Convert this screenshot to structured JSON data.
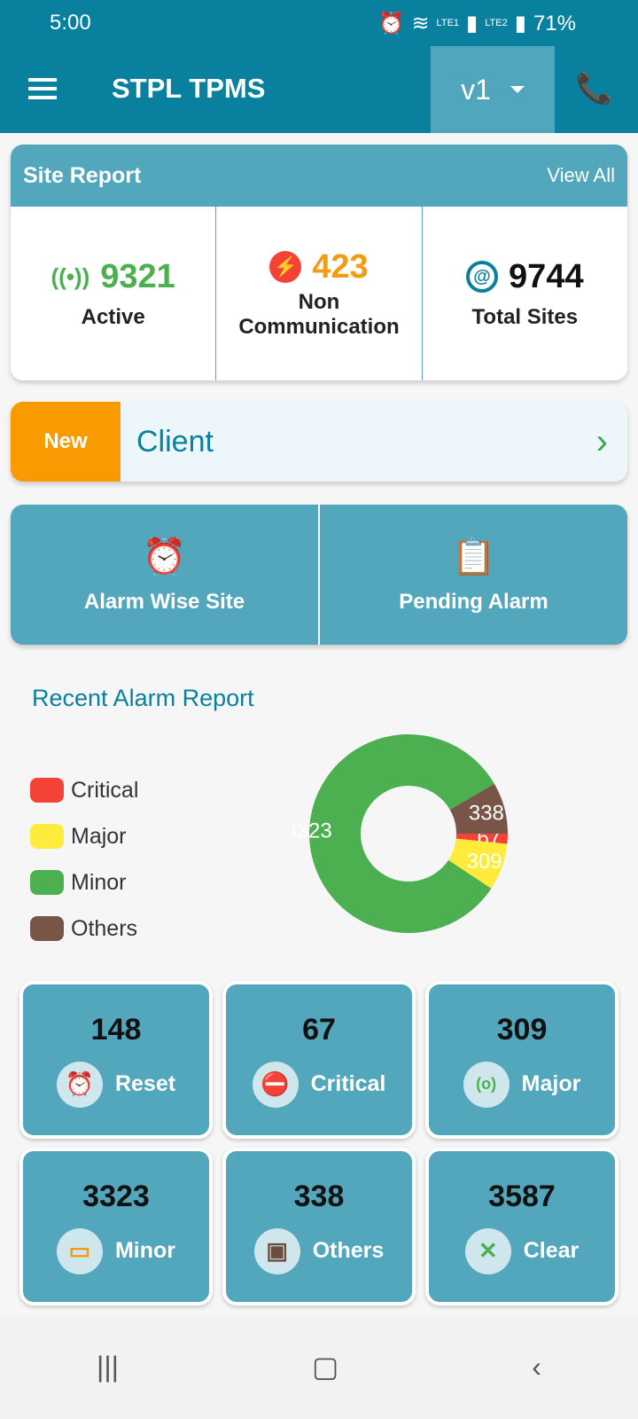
{
  "status_bar": {
    "time": "5:00",
    "battery": "71%",
    "sim1": "LTE1",
    "sim2": "LTE2"
  },
  "app_bar": {
    "title": "STPL TPMS",
    "version": "v1"
  },
  "site_report": {
    "title": "Site Report",
    "view_all": "View All",
    "active": {
      "value": "9321",
      "label": "Active",
      "color": "#4caf50"
    },
    "non_comm": {
      "value": "423",
      "label": "Non Communication",
      "color": "#f39c12"
    },
    "total": {
      "value": "9744",
      "label": "Total Sites",
      "color": "#111111"
    }
  },
  "client": {
    "badge": "New",
    "label": "Client"
  },
  "actions": {
    "alarm_wise": "Alarm Wise Site",
    "pending": "Pending Alarm"
  },
  "recent": {
    "title": "Recent Alarm Report"
  },
  "chart_data": {
    "type": "pie",
    "donut": true,
    "categories": [
      "Critical",
      "Major",
      "Minor",
      "Others"
    ],
    "values": [
      67,
      309,
      3323,
      338
    ],
    "colors": [
      "#f44336",
      "#ffeb3b",
      "#4caf50",
      "#795548"
    ],
    "legend": "left"
  },
  "tiles": [
    {
      "value": "148",
      "label": "Reset",
      "icon": "alarm-clock-icon"
    },
    {
      "value": "67",
      "label": "Critical",
      "icon": "error-octagon-icon"
    },
    {
      "value": "309",
      "label": "Major",
      "icon": "signal-box-icon"
    },
    {
      "value": "3323",
      "label": "Minor",
      "icon": "monitor-icon"
    },
    {
      "value": "338",
      "label": "Others",
      "icon": "devices-icon"
    },
    {
      "value": "3587",
      "label": "Clear",
      "icon": "close-icon"
    }
  ]
}
